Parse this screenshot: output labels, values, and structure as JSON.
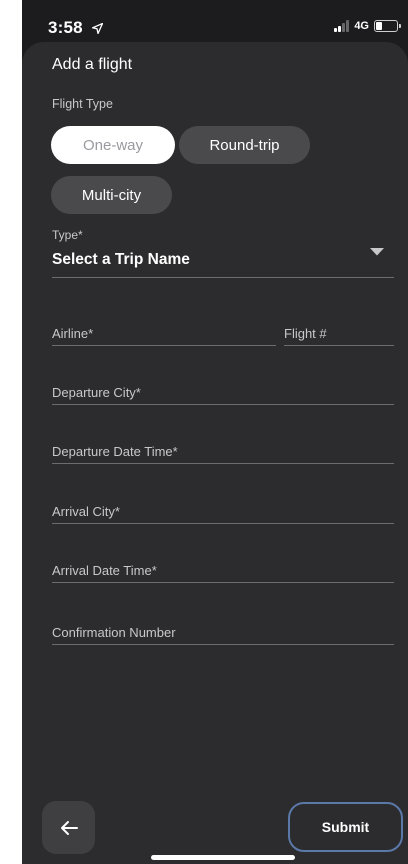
{
  "status_bar": {
    "time": "3:58",
    "network": "4G",
    "signal_bars_active": 2,
    "signal_bars_total": 4,
    "battery_level": 0.3,
    "location_icon": "location-arrow-icon"
  },
  "form": {
    "title": "Add a flight",
    "flight_type_label": "Flight Type",
    "flight_types": [
      {
        "label": "One-way",
        "selected": true
      },
      {
        "label": "Round-trip",
        "selected": false
      },
      {
        "label": "Multi-city",
        "selected": false
      }
    ],
    "type_label": "Type*",
    "type_value": "Select a Trip Name",
    "fields": {
      "airline": "Airline*",
      "flight_number": "Flight #",
      "departure_city": "Departure City*",
      "departure_datetime": "Departure Date Time*",
      "arrival_city": "Arrival City*",
      "arrival_datetime": "Arrival Date Time*",
      "confirmation_number": "Confirmation Number"
    }
  },
  "footer": {
    "back_icon": "arrow-left-icon",
    "submit_label": "Submit"
  },
  "colors": {
    "background": "#1c1c1e",
    "sheet": "#2c2c2e",
    "chip_selected_bg": "#ffffff",
    "chip_bg": "#4a4a4d",
    "divider": "#6c6c70",
    "submit_border": "#5a78a8"
  }
}
